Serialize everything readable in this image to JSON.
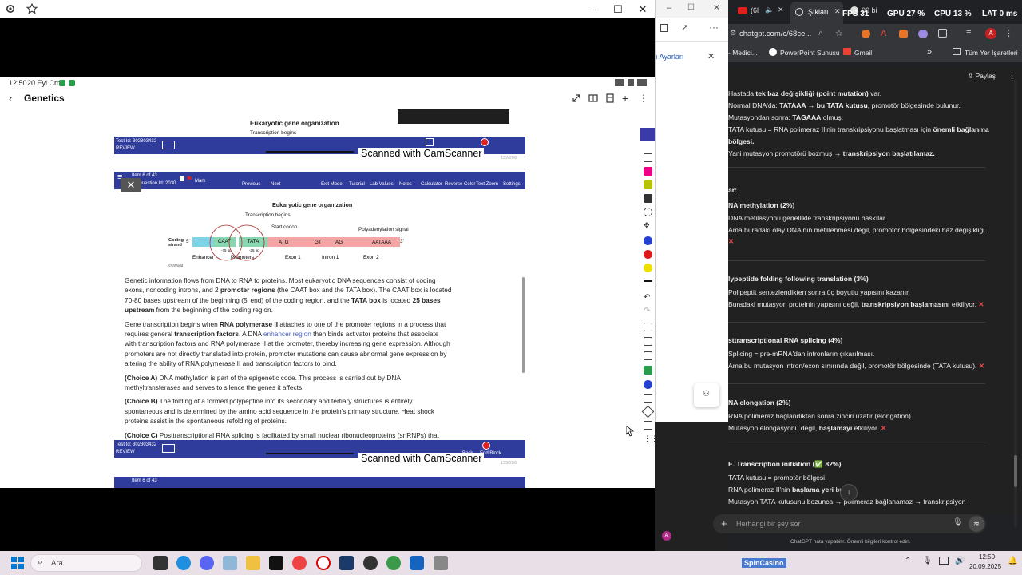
{
  "left_window": {
    "status_time": "12:50",
    "status_date": "20 Eyl Cmt",
    "app_title": "Genetics",
    "page1": {
      "figure_title": "Eukaryotic gene organization",
      "figure_sub": "Transcription begins",
      "test_id": "Test Id: 302803432",
      "review": "REVIEW",
      "cam": "Scanned with CamScanner",
      "page_num": "132/298"
    },
    "page2": {
      "item_label": "Item 6 of 43",
      "question_id": "Question Id: 2030",
      "mark": "Mark",
      "toolbar": [
        "Previous",
        "Next",
        "Exit Mode",
        "Tutorial",
        "Lab Values",
        "Notes",
        "Calculator",
        "Reverse Color",
        "Text Zoom",
        "Settings"
      ],
      "figure_title": "Eukaryotic gene organization",
      "figure_transcription": "Transcription begins",
      "figure_start_codon": "Start codon",
      "figure_polya": "Polyadenylation signal",
      "figure_coding": "Coding strand",
      "figure_5": "5'",
      "figure_3": "3'",
      "figure_caat": "CAAT",
      "figure_tata": "TATA",
      "figure_75": "-75 bp",
      "figure_25": "-25 bp",
      "figure_atg": "ATG",
      "figure_gt": "GT",
      "figure_ag": "AG",
      "figure_aataaa": "AATAAA",
      "figure_enhancer": "Enhancer",
      "figure_promoters": "Promoters",
      "figure_exon1": "Exon 1",
      "figure_intron1": "Intron 1",
      "figure_exon2": "Exon 2",
      "figure_credit": "©UWorld",
      "para1_a": "Genetic information flows from DNA to RNA to proteins.  Most eukaryotic DNA sequences consist of coding exons, noncoding introns, and 2 ",
      "para1_b": "promoter regions",
      "para1_c": " (the CAAT box and the TATA box).  The CAAT box is located 70-80 bases upstream of the beginning (5' end) of the coding region, and the ",
      "para1_d": "TATA box",
      "para1_e": " is located ",
      "para1_f": "25 bases upstream",
      "para1_g": " from the beginning of the coding region.",
      "para2_a": "Gene transcription begins when ",
      "para2_b": "RNA polymerase II",
      "para2_c": " attaches to one of the promoter regions in a process that requires general ",
      "para2_d": "transcription factors",
      "para2_e": ".  A DNA ",
      "para2_link": "enhancer region",
      "para2_f": " then binds activator proteins that associate with transcription factors and RNA polymerase II at the promoter, thereby increasing gene expression.  Although promoters are not directly translated into protein, promoter mutations can cause abnormal gene expression by altering the ability of RNA polymerase II and transcription factors to bind.",
      "choiceA_label": "(Choice A)",
      "choiceA_text": "  DNA methylation is part of the epigenetic code.  This process is carried out by DNA methyltransferases and serves to silence the genes it affects.",
      "choiceB_label": "(Choice B)",
      "choiceB_text": "  The folding of a formed polypeptide into its secondary and tertiary structures is entirely spontaneous and is determined by the amino acid sequence in the protein's primary structure.  Heat shock proteins assist in the spontaneous refolding of proteins.",
      "choiceC_label": "(Choice C)",
      "choiceC_text": "  Posttranscriptional RNA splicing is facilitated by small nuclear ribonucleoproteins (snRNPs) that",
      "test_id": "Test Id: 302803432",
      "review": "REVIEW",
      "cam": "Scanned with CamScanner",
      "page_num": "133/298"
    },
    "page3": {
      "item_label": "Item 6 of 43"
    },
    "footer_back": "Back",
    "footer_end": "End Block"
  },
  "mid_panel": {
    "title": "ı Ayarları"
  },
  "browser": {
    "tab1": "(6l",
    "tab2": "Şıkları",
    "tab3": "00 bi",
    "url": "chatgpt.com/c/68ce...",
    "bookmarks": [
      "- Medici...",
      "PowerPoint Sunusu",
      "Gmail"
    ],
    "all_bookmarks": "Tüm Yer İşaretleri",
    "share": "Paylaş",
    "stats": {
      "fps": "FPS 31",
      "gpu": "GPU 27 %",
      "cpu": "CPU 13 %",
      "lat": "LAT 0 ms"
    },
    "chat": {
      "l1_a": "Hastada ",
      "l1_b": "tek baz değişikliği (point mutation)",
      "l1_c": " var.",
      "l2_a": "Normal DNA'da: ",
      "l2_b": "TATAAA → bu TATA kutusu",
      "l2_c": ", promotör bölgesinde bulunur.",
      "l3_a": "Mutasyondan sonra: ",
      "l3_b": "TAGAAA",
      "l3_c": " olmuş.",
      "l4_a": "TATA kutusu = RNA polimeraz II'nin transkripsiyonu başlatması için ",
      "l4_b": "önemli bağlanma",
      "l5": "bölgesi.",
      "l6_a": "Yani mutasyon promotörü bozmuş → ",
      "l6_b": "transkripsiyon başlatılamaz.",
      "h_ar": "ar:",
      "hA": "NA methylation (2%)",
      "a1": "DNA metilasyonu genellikle transkripsiyonu baskılar.",
      "a2": "Ama buradaki olay DNA'nın metillenmesi değil, promotör bölgesindeki baz değişikliği.",
      "hB": "lypeptide folding following translation (3%)",
      "b1": "Polipeptit sentezlendikten sonra üç boyutlu yapısını kazanır.",
      "b2_a": "Buradaki mutasyon proteinin yapısını değil, ",
      "b2_b": "transkripsiyon başlamasını",
      "b2_c": " etkiliyor.",
      "hC": "sttranscriptional RNA splicing (4%)",
      "c1": "Splicing = pre-mRNA'dan intronların çıkarılması.",
      "c2": "Ama bu mutasyon intron/exon sınırında değil, promotör bölgesinde (TATA kutusu).",
      "hD": "NA elongation (2%)",
      "d1": "RNA polimeraz bağlandıktan sonra zinciri uzatır (elongation).",
      "d2_a": "Mutasyon elongasyonu değil, ",
      "d2_b": "başlamayı",
      "d2_c": " etkiliyor.",
      "hE": "E. Transcription initiation (✅ 82%)",
      "e1": "TATA kutusu = promotör bölgesi.",
      "e2_a": "RNA polimeraz II'nin ",
      "e2_b": "başlama yeri",
      "e2_c": " burası.",
      "e3": "Mutasyon TATA kutusunu bozunca → polimeraz bağlanamaz → transkripsiyon",
      "xmark": "✕",
      "input_placeholder": "Herhangi bir şey sor",
      "disclaimer": "ChatGPT hata yapabilir. Önemli bilgileri kontrol edin."
    }
  },
  "taskbar": {
    "search_placeholder": "Ara",
    "spin": "SpinCasino",
    "time": "12:50",
    "date": "20.09.2025"
  },
  "colors": {
    "uworld_blue": "#2f3c9c",
    "chat_bg": "#212121",
    "browser_bg": "#202124",
    "taskbar_bg": "#e9dfe7",
    "red_x": "#e5484d"
  }
}
